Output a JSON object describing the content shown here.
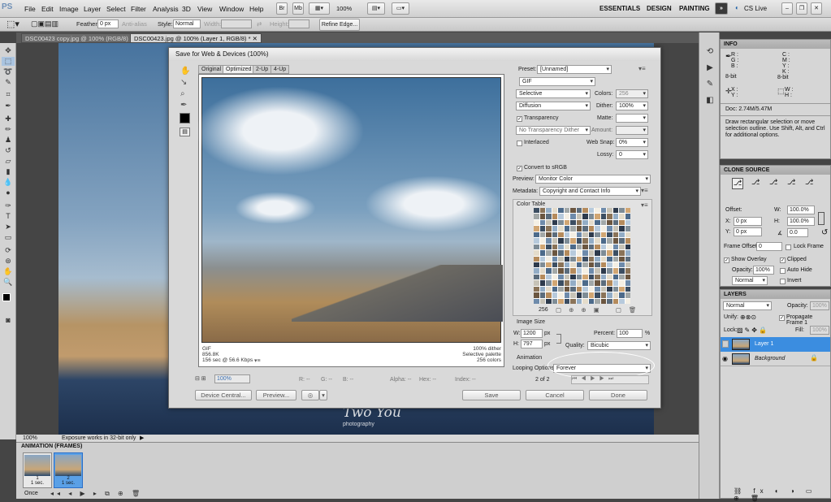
{
  "app": {
    "logo": "PS"
  },
  "menu": [
    "File",
    "Edit",
    "Image",
    "Layer",
    "Select",
    "Filter",
    "Analysis",
    "3D",
    "View",
    "Window",
    "Help"
  ],
  "appbar": {
    "zoom": "100%",
    "workspaces": [
      "ESSENTIALS",
      "DESIGN",
      "PAINTING"
    ],
    "overflow": "»",
    "cslive": "CS Live"
  },
  "options": {
    "feather_label": "Feather:",
    "feather_value": "0 px",
    "antialias": "Anti-alias",
    "style_label": "Style:",
    "style_value": "Normal",
    "width_label": "Width:",
    "height_label": "Height:",
    "refine_edge": "Refine Edge..."
  },
  "documents": [
    {
      "title": "DSC00423 copy.jpg @ 100% (RGB/8)"
    },
    {
      "title": "DSC00423.jpg @ 100% (Layer 1, RGB/8) *"
    }
  ],
  "status": {
    "zoom": "100%",
    "message": "Exposure works in 32-bit only"
  },
  "watermark": {
    "line1": "Two You",
    "line2": "photography"
  },
  "animation": {
    "title": "ANIMATION (FRAMES)",
    "frames": [
      {
        "number": "1",
        "delay": "1 sec."
      },
      {
        "number": "2",
        "delay": "1 sec."
      }
    ],
    "loop": "Once"
  },
  "info_panel": {
    "title": "INFO",
    "left_channels": [
      "R :",
      "G :",
      "B :"
    ],
    "right_channels": [
      "C :",
      "M :",
      "Y :",
      "K :"
    ],
    "bitdepth_left": "8-bit",
    "bitdepth_right": "8-bit",
    "xy_left": [
      "X :",
      "Y :"
    ],
    "wh_right": [
      "W :",
      "H :"
    ],
    "doc": "Doc: 2.74M/5.47M",
    "hint": "Draw rectangular selection or move selection outline. Use Shift, Alt, and Ctrl for additional options."
  },
  "clone_panel": {
    "title": "CLONE SOURCE",
    "offset_label": "Offset:",
    "x": "0 px",
    "y": "0 px",
    "w": "100.0%",
    "h": "100.0%",
    "angle": "0.0",
    "frame_offset_label": "Frame Offset:",
    "frame_offset": "0",
    "lock_frame": "Lock Frame",
    "show_overlay": "Show Overlay",
    "clipped": "Clipped",
    "opacity_label": "Opacity:",
    "opacity": "100%",
    "auto_hide": "Auto Hide",
    "blend": "Normal",
    "invert": "Invert"
  },
  "layers_panel": {
    "title": "LAYERS",
    "blend": "Normal",
    "opacity_label": "Opacity:",
    "opacity": "100%",
    "unify": "Unify:",
    "propagate": "Propagate Frame 1",
    "lock": "Lock:",
    "fill_label": "Fill:",
    "fill": "100%",
    "layers": [
      {
        "name": "Layer 1"
      },
      {
        "name": "Background"
      }
    ]
  },
  "dialog": {
    "title": "Save for Web & Devices (100%)",
    "tabs": [
      "Original",
      "Optimized",
      "2-Up",
      "4-Up"
    ],
    "preset_label": "Preset:",
    "preset_value": "[Unnamed]",
    "format": "GIF",
    "reduction": "Selective",
    "colors_label": "Colors:",
    "colors_value": "256",
    "dither_algo": "Diffusion",
    "dither_label": "Dither:",
    "dither_value": "100%",
    "transparency": "Transparency",
    "matte_label": "Matte:",
    "trans_dither": "No Transparency Dither",
    "amount_label": "Amount:",
    "interlaced": "Interlaced",
    "websnap_label": "Web Snap:",
    "websnap_value": "0%",
    "lossy_label": "Lossy:",
    "lossy_value": "0",
    "convert_srgb": "Convert to sRGB",
    "preview_label": "Preview:",
    "preview_value": "Monitor Color",
    "metadata_label": "Metadata:",
    "metadata_value": "Copyright and Contact Info",
    "color_table_label": "Color Table",
    "color_count": "256",
    "image_size_label": "Image Size",
    "w_label": "W:",
    "w_value": "1200",
    "h_label": "H:",
    "h_value": "797",
    "px": "px",
    "percent_label": "Percent:",
    "percent_value": "100",
    "pct": "%",
    "quality_label": "Quality:",
    "quality_value": "Bicubic",
    "animation_label": "Animation",
    "looping_label": "Looping Options:",
    "looping_value": "Forever",
    "frame_counter": "2 of 2",
    "info_left": [
      "GIF",
      "856.8K",
      "156 sec @ 56.6 Kbps"
    ],
    "info_right": [
      "100% dither",
      "Selective palette",
      "256 colors"
    ],
    "zoom": "100%",
    "readouts": [
      "R: --",
      "G: --",
      "B: --",
      "Alpha: --",
      "Hex: --",
      "Index: --"
    ],
    "buttons": {
      "device_central": "Device Central...",
      "preview": "Preview...",
      "save": "Save",
      "cancel": "Cancel",
      "done": "Done"
    }
  },
  "palette_colors": [
    "#3c4e62",
    "#5b6c7c",
    "#7e8c96",
    "#a2a8a8",
    "#c7c3b7",
    "#e4dccb",
    "#f4efe4",
    "#8a7358",
    "#b58b5c",
    "#d1a673",
    "#6b5640",
    "#2d3a4c",
    "#4c6a8a",
    "#6e8bab",
    "#93adc6",
    "#b7cadc"
  ]
}
